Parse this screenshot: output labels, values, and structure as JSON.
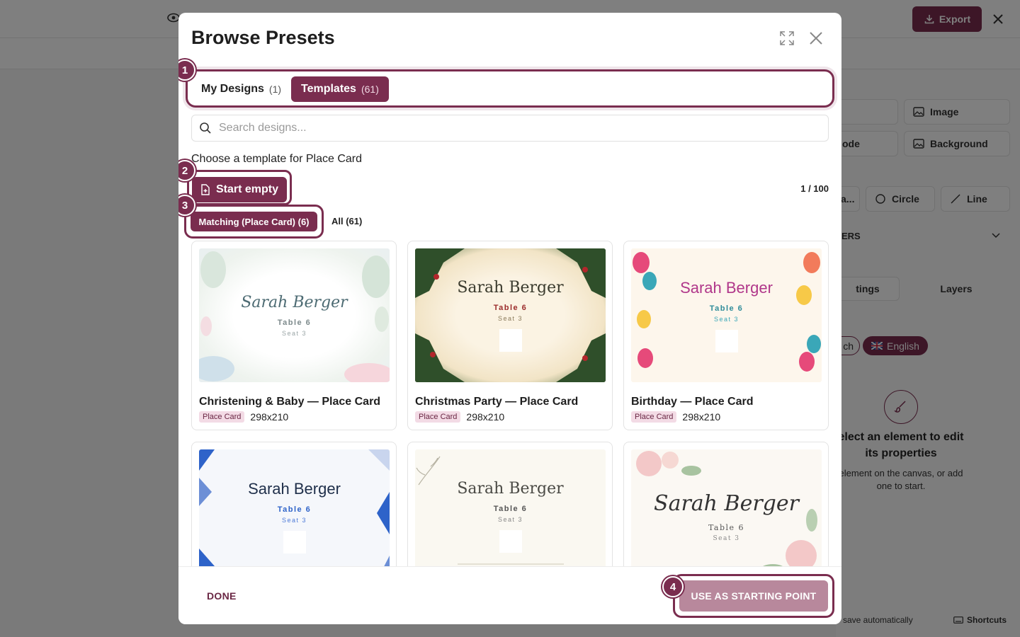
{
  "app": {
    "export_label": "Export",
    "right_panel": {
      "image_label": "Image",
      "code_label": "ode",
      "background_label": "Background",
      "ellipsis_label": "a...",
      "circle_label": "Circle",
      "line_label": "Line",
      "section_label": "ERS",
      "settings_tab": "tings",
      "layers_tab": "Layers",
      "lang_prev": "ch",
      "lang_active": "English",
      "empty_title": "elect an element to edit its properties",
      "empty_sub": "element on the canvas, or add one to start.",
      "status_auto": "save automatically",
      "status_shortcuts": "Shortcuts"
    }
  },
  "modal": {
    "title": "Browse Presets",
    "tabs": [
      {
        "label": "My Designs",
        "count": "(1)"
      },
      {
        "label": "Templates",
        "count": "(61)"
      }
    ],
    "search": {
      "placeholder": "Search designs..."
    },
    "choose_text": "Choose a template for Place Card",
    "start_empty_label": "Start empty",
    "page_count": "1 / 100",
    "filters": {
      "matching": "Matching (Place Card) (6)",
      "all": "All (61)"
    },
    "badges": [
      "1",
      "2",
      "3",
      "4"
    ],
    "cards": [
      {
        "title": "Christening & Baby — Place Card",
        "tag": "Place Card",
        "size": "298x210",
        "name": "Sarah Berger",
        "table": "Table 6",
        "seat": "Seat 3"
      },
      {
        "title": "Christmas Party — Place Card",
        "tag": "Place Card",
        "size": "298x210",
        "name": "Sarah Berger",
        "table": "Table 6",
        "seat": "Seat 3"
      },
      {
        "title": "Birthday — Place Card",
        "tag": "Place Card",
        "size": "298x210",
        "name": "Sarah Berger",
        "table": "Table 6",
        "seat": "Seat 3"
      },
      {
        "title": "",
        "tag": "",
        "size": "",
        "name": "Sarah Berger",
        "table": "Table 6",
        "seat": "Seat 3"
      },
      {
        "title": "",
        "tag": "",
        "size": "",
        "name": "Sarah Berger",
        "table": "Table 6",
        "seat": "Seat 3"
      },
      {
        "title": "",
        "tag": "",
        "size": "",
        "name": "Sarah Berger",
        "table": "Table 6",
        "seat": "Seat 3"
      }
    ],
    "footer": {
      "done_label": "DONE",
      "use_label": "USE AS STARTING POINT"
    }
  },
  "colors": {
    "accent": "#7a2d4f",
    "accent_light": "#b8889c",
    "overlay": "rgba(0,0,0,0.5)"
  }
}
